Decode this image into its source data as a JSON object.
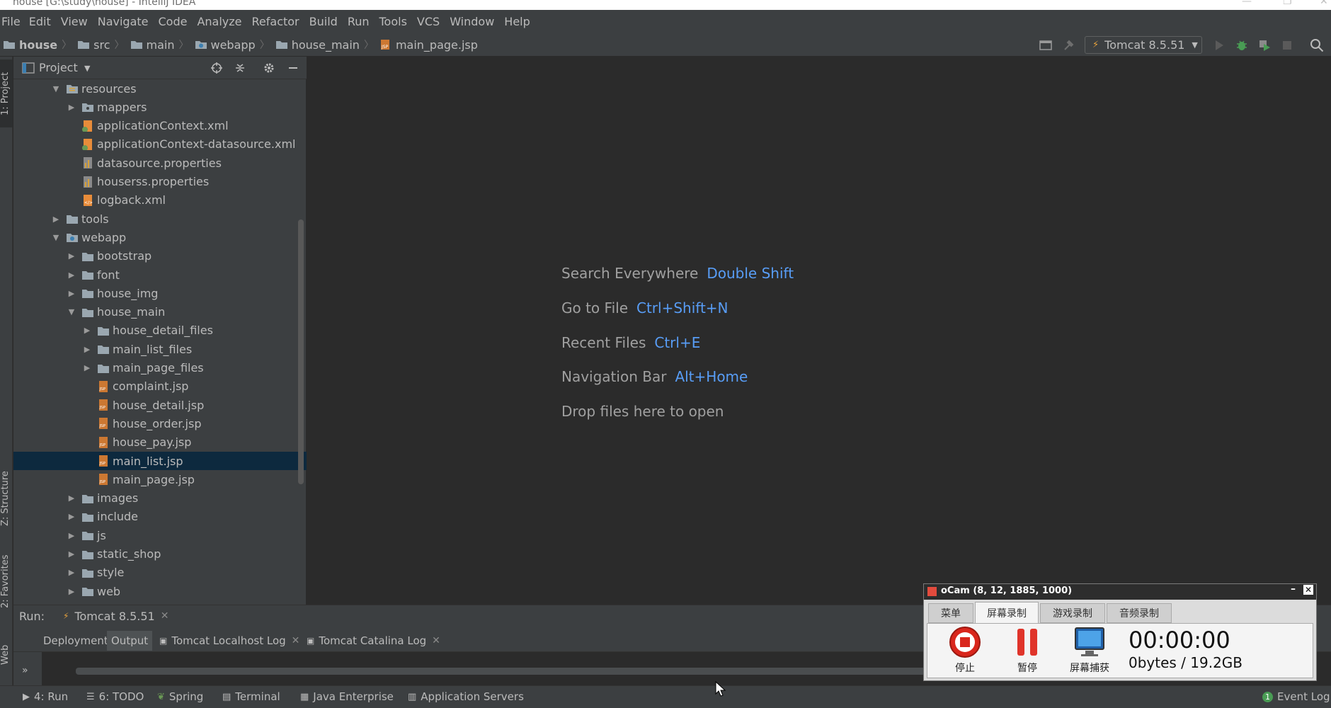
{
  "window": {
    "title": "house [G:\\study\\house] - IntelliJ IDEA"
  },
  "menu": [
    "File",
    "Edit",
    "View",
    "Navigate",
    "Code",
    "Analyze",
    "Refactor",
    "Build",
    "Run",
    "Tools",
    "VCS",
    "Window",
    "Help"
  ],
  "breadcrumb": [
    "house",
    "src",
    "main",
    "webapp",
    "house_main",
    "main_page.jsp"
  ],
  "toolbar": {
    "run_config": "Tomcat 8.5.51"
  },
  "left_strip": {
    "project_tab": "1: Project",
    "structure_tab": "Z: Structure",
    "favorites_tab": "2: Favorites",
    "web_tab": "Web"
  },
  "project": {
    "title": "Project",
    "tree": [
      {
        "label": "resources",
        "level": 0,
        "kind": "res-folder",
        "expanded": true
      },
      {
        "label": "mappers",
        "level": 1,
        "kind": "pkg-folder",
        "expanded": false
      },
      {
        "label": "applicationContext.xml",
        "level": 1,
        "kind": "spring-xml"
      },
      {
        "label": "applicationContext-datasource.xml",
        "level": 1,
        "kind": "spring-xml"
      },
      {
        "label": "datasource.properties",
        "level": 1,
        "kind": "properties"
      },
      {
        "label": "houserss.properties",
        "level": 1,
        "kind": "properties"
      },
      {
        "label": "logback.xml",
        "level": 1,
        "kind": "xml"
      },
      {
        "label": "tools",
        "level": 0,
        "kind": "folder",
        "expanded": false
      },
      {
        "label": "webapp",
        "level": 0,
        "kind": "web-folder",
        "expanded": true
      },
      {
        "label": "bootstrap",
        "level": 1,
        "kind": "folder",
        "expanded": false
      },
      {
        "label": "font",
        "level": 1,
        "kind": "folder",
        "expanded": false
      },
      {
        "label": "house_img",
        "level": 1,
        "kind": "folder",
        "expanded": false
      },
      {
        "label": "house_main",
        "level": 1,
        "kind": "folder",
        "expanded": true
      },
      {
        "label": "house_detail_files",
        "level": 2,
        "kind": "folder",
        "expanded": false
      },
      {
        "label": "main_list_files",
        "level": 2,
        "kind": "folder",
        "expanded": false
      },
      {
        "label": "main_page_files",
        "level": 2,
        "kind": "folder",
        "expanded": false
      },
      {
        "label": "complaint.jsp",
        "level": 2,
        "kind": "jsp"
      },
      {
        "label": "house_detail.jsp",
        "level": 2,
        "kind": "jsp"
      },
      {
        "label": "house_order.jsp",
        "level": 2,
        "kind": "jsp"
      },
      {
        "label": "house_pay.jsp",
        "level": 2,
        "kind": "jsp"
      },
      {
        "label": "main_list.jsp",
        "level": 2,
        "kind": "jsp",
        "selected": true
      },
      {
        "label": "main_page.jsp",
        "level": 2,
        "kind": "jsp"
      },
      {
        "label": "images",
        "level": 1,
        "kind": "folder",
        "expanded": false
      },
      {
        "label": "include",
        "level": 1,
        "kind": "folder",
        "expanded": false
      },
      {
        "label": "js",
        "level": 1,
        "kind": "folder",
        "expanded": false
      },
      {
        "label": "static_shop",
        "level": 1,
        "kind": "folder",
        "expanded": false
      },
      {
        "label": "style",
        "level": 1,
        "kind": "folder",
        "expanded": false
      },
      {
        "label": "web",
        "level": 1,
        "kind": "folder",
        "expanded": false
      }
    ]
  },
  "editor": {
    "hints": [
      {
        "label": "Search Everywhere",
        "shortcut": "Double Shift"
      },
      {
        "label": "Go to File",
        "shortcut": "Ctrl+Shift+N"
      },
      {
        "label": "Recent Files",
        "shortcut": "Ctrl+E"
      },
      {
        "label": "Navigation Bar",
        "shortcut": "Alt+Home"
      },
      {
        "label": "Drop files here to open",
        "shortcut": ""
      }
    ]
  },
  "run_panel": {
    "title": "Run:",
    "tab": "Tomcat 8.5.51",
    "subtabs": [
      "Deployment",
      "Output",
      "Tomcat Localhost Log",
      "Tomcat Catalina Log"
    ]
  },
  "bottom_tools": [
    {
      "label": "4: Run",
      "icon": "play-icon"
    },
    {
      "label": "6: TODO",
      "icon": "list-icon"
    },
    {
      "label": "Spring",
      "icon": "spring-icon"
    },
    {
      "label": "Terminal",
      "icon": "terminal-icon"
    },
    {
      "label": "Java Enterprise",
      "icon": "java-ee-icon"
    },
    {
      "label": "Application Servers",
      "icon": "server-icon"
    }
  ],
  "event_log": {
    "label": "Event Log",
    "count": "1"
  },
  "ocam": {
    "title": "oCam (8, 12, 1885, 1000)",
    "tabs": [
      "菜单",
      "屏幕录制",
      "游戏录制",
      "音频录制"
    ],
    "buttons": [
      "停止",
      "暂停",
      "屏幕捕获"
    ],
    "timer": "00:00:00",
    "size": "0bytes / 19.2GB"
  },
  "colors": {
    "bg": "#2b2b2b",
    "panel": "#3c3f41",
    "selection": "#0d293e",
    "shortcut": "#589df6",
    "folder": "#9aa7b0",
    "jsp": "#cc7832"
  }
}
